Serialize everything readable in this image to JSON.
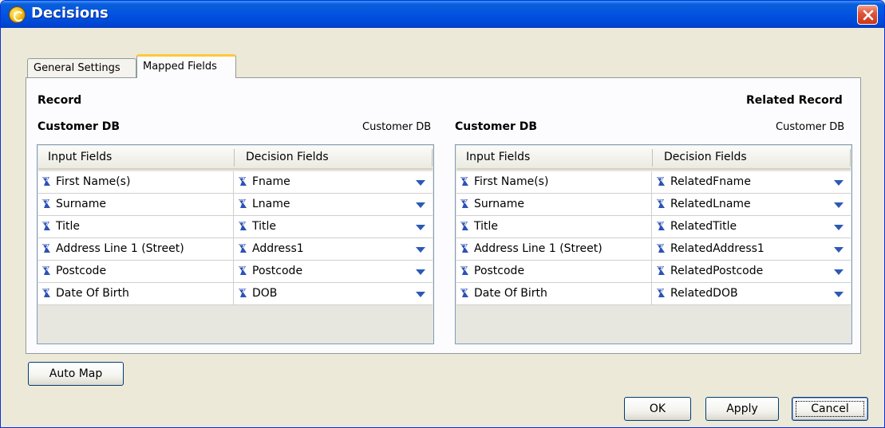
{
  "window": {
    "title": "Decisions",
    "icon": "decision-app-icon",
    "close_icon": "close-x-icon"
  },
  "tabs": [
    {
      "label": "General Settings",
      "active": false
    },
    {
      "label": "Mapped Fields",
      "active": true
    }
  ],
  "left": {
    "section_title": "Record",
    "db_name": "Customer DB",
    "db_name_right": "Customer DB",
    "columns": [
      "Input Fields",
      "Decision Fields"
    ],
    "rows": [
      {
        "input": "First Name(s)",
        "decision": "Fname"
      },
      {
        "input": "Surname",
        "decision": "Lname"
      },
      {
        "input": "Title",
        "decision": "Title"
      },
      {
        "input": "Address Line 1 (Street)",
        "decision": "Address1"
      },
      {
        "input": "Postcode",
        "decision": "Postcode"
      },
      {
        "input": "Date Of Birth",
        "decision": "DOB"
      }
    ]
  },
  "right": {
    "section_title": "Related Record",
    "db_name": "Customer DB",
    "db_name_right": "Customer DB",
    "columns": [
      "Input Fields",
      "Decision Fields"
    ],
    "rows": [
      {
        "input": "First Name(s)",
        "decision": "RelatedFname"
      },
      {
        "input": "Surname",
        "decision": "RelatedLname"
      },
      {
        "input": "Title",
        "decision": "RelatedTitle"
      },
      {
        "input": "Address Line 1 (Street)",
        "decision": "RelatedAddress1"
      },
      {
        "input": "Postcode",
        "decision": "RelatedPostcode"
      },
      {
        "input": "Date Of Birth",
        "decision": "RelatedDOB"
      }
    ]
  },
  "buttons": {
    "auto_map": "Auto Map",
    "ok": "OK",
    "apply": "Apply",
    "cancel": "Cancel"
  },
  "colors": {
    "titlebar": "#0054e3",
    "tab_highlight": "#ffc83c",
    "dropdown_arrow": "#2a5ab8",
    "field_icon": "#2b52b6"
  }
}
